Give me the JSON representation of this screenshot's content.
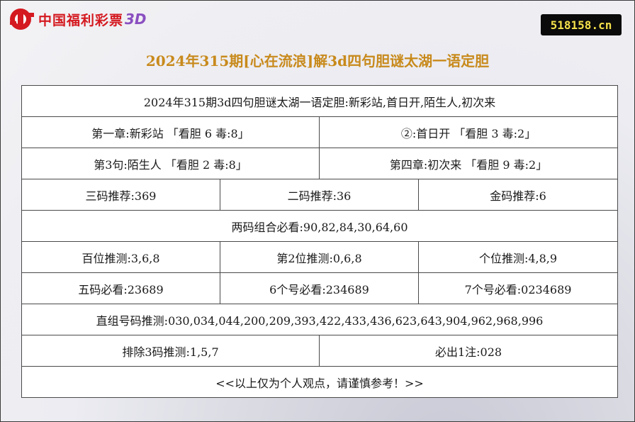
{
  "logo": {
    "text": "中国福利彩票",
    "suffix": "3D"
  },
  "site_badge": "518158.cn",
  "page_title": "2024年315期[心在流浪]解3d四句胆谜太湖一语定胆",
  "rows": {
    "headline": "2024年315期3d四句胆谜太湖一语定胆:新彩站,首日开,陌生人,初次来",
    "r2": [
      "第一章:新彩站 「看胆 6 毒:8」",
      "②:首日开 「看胆 3 毒:2」"
    ],
    "r3": [
      "第3句:陌生人 「看胆 2 毒:8」",
      "第四章:初次来 「看胆 9 毒:2」"
    ],
    "r4": [
      "三码推荐:369",
      "二码推荐:36",
      "金码推荐:6"
    ],
    "r5": "两码组合必看:90,82,84,30,64,60",
    "r6": [
      "百位推测:3,6,8",
      "第2位推测:0,6,8",
      "个位推测:4,8,9"
    ],
    "r7": [
      "五码必看:23689",
      "6个号必看:234689",
      "7个号必看:0234689"
    ],
    "r8": "直组号码推测:030,034,044,200,209,393,422,433,436,623,643,904,962,968,996",
    "r9": [
      "排除3码推测:1,5,7",
      "必出1注:028"
    ],
    "r10": "<<以上仅为个人观点，请谨慎参考！>>"
  }
}
